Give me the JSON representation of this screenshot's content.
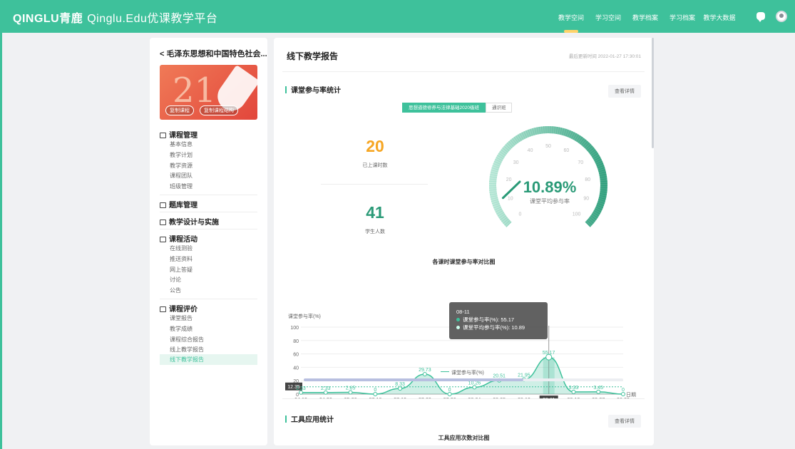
{
  "header": {
    "logo": "QINGLU青鹿",
    "logo_sub": "Qinglu.Edu优课教学平台",
    "nav": [
      "教学空间",
      "学习空间",
      "教学档案",
      "学习档案",
      "教学大数据"
    ],
    "active_nav": "教学空间"
  },
  "sidebar": {
    "course_title": "< 毛泽东思想和中国特色社会...",
    "cover_text": "21",
    "cover_tags": [
      "复制课程",
      "复制课程结构"
    ],
    "groups": [
      {
        "label": "课程管理",
        "icon": "book-icon",
        "items": [
          "基本信息",
          "教学计划",
          "教学资源",
          "课程团队",
          "班级管理"
        ]
      },
      {
        "label": "题库管理",
        "icon": "question-bank-icon",
        "items": []
      },
      {
        "label": "教学设计与实施",
        "icon": "design-icon",
        "items": []
      },
      {
        "label": "课程活动",
        "icon": "activity-icon",
        "items": [
          "在线测验",
          "推送资料",
          "网上答疑",
          "讨论",
          "公告"
        ]
      },
      {
        "label": "课程评价",
        "icon": "evaluation-icon",
        "items": [
          "课堂报告",
          "教学成绩",
          "课程综合报告",
          "线上教学报告",
          "线下教学报告"
        ]
      }
    ],
    "active_item": "线下教学报告"
  },
  "main": {
    "title": "线下教学报告",
    "update_time": "最后更新时间 2022-01-27 17:30:01",
    "section1": {
      "title": "课堂参与率统计",
      "detail": "查看详情",
      "tabs": [
        "思想道德修养与法律基础2020级班",
        "通识班"
      ],
      "lessons": "20",
      "lessons_label": "已上课时数",
      "students": "41",
      "students_label": "学生人数",
      "gauge_value": "10.89%",
      "gauge_label": "课堂平均参与率",
      "gauge_ticks": [
        "0",
        "10",
        "20",
        "30",
        "40",
        "50",
        "60",
        "70",
        "80",
        "90",
        "100"
      ]
    },
    "section2": {
      "title": "工具应用统计",
      "detail": "查看详情",
      "chart_title": "工具应用次数对比图"
    },
    "tooltip": {
      "title": "08-11",
      "l1": "课堂参与率(%): 55.17",
      "l2": "课堂平均参与率(%): 10.89"
    }
  },
  "chart_data": {
    "type": "area",
    "title": "各课时课堂参与率对比图",
    "ylabel": "课堂参与率(%)",
    "xlabel": "日期",
    "x": [
      "04-19",
      "04-30",
      "05-06",
      "07-16",
      "07-19",
      "07-20",
      "07-26",
      "08-04",
      "08-05",
      "08-10",
      "08-11",
      "08-19",
      "08-27",
      "08-30"
    ],
    "series": [
      {
        "name": "课堂参与率(%)",
        "values": [
          2.33,
          2.33,
          2.65,
          0,
          8.33,
          29.73,
          0,
          10.26,
          20.51,
          21.95,
          55.17,
          3.33,
          3.45,
          0
        ]
      }
    ],
    "average": 10.89,
    "average_label": "12.35",
    "ylim": [
      0,
      100
    ],
    "yticks": [
      0,
      20,
      40,
      60,
      80,
      100
    ],
    "point_labels": [
      "2.33",
      "2.33",
      "2.65",
      "0",
      "8.33",
      "29.73",
      "0",
      "10.26",
      "20.51",
      "21.95",
      "55.17",
      "3.33",
      "3.45",
      "0"
    ]
  },
  "colors": {
    "brand": "#3ec19b",
    "brand_dark": "#2a9a77"
  }
}
